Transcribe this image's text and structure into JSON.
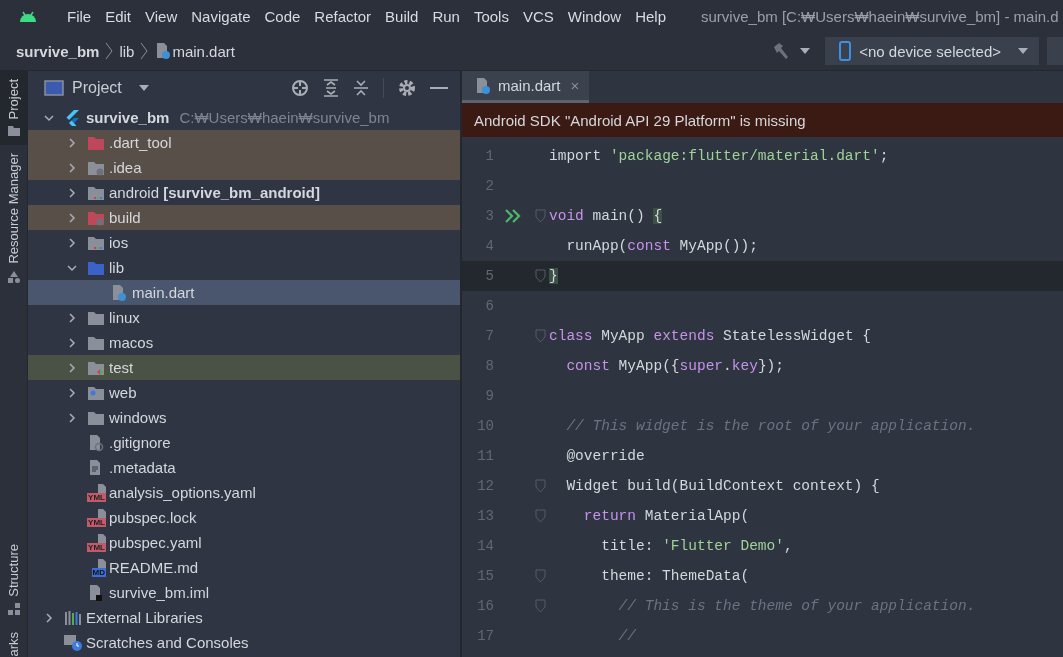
{
  "menu_bar": {
    "items": [
      "File",
      "Edit",
      "View",
      "Navigate",
      "Code",
      "Refactor",
      "Build",
      "Run",
      "Tools",
      "VCS",
      "Window",
      "Help"
    ],
    "window_title": "survive_bm [C:₩Users₩haein₩survive_bm] - main.d"
  },
  "breadcrumbs": [
    {
      "label": "survive_bm",
      "kind": "project"
    },
    {
      "label": "lib",
      "kind": "folder"
    },
    {
      "label": "main.dart",
      "kind": "file"
    }
  ],
  "device_selector": {
    "label": "<no device selected>"
  },
  "tool_strip": {
    "top": [
      {
        "label": "Project",
        "selected": true
      },
      {
        "label": "Resource Manager",
        "selected": false
      }
    ],
    "bottom": [
      {
        "label": "Structure",
        "selected": false
      },
      {
        "label": "arks",
        "selected": false
      }
    ]
  },
  "project_panel": {
    "title": "Project",
    "tree": [
      {
        "label": "survive_bm",
        "path": "C:₩Users₩haein₩survive_bm",
        "kind": "flutter",
        "expanded": true,
        "selected": false,
        "children": [
          {
            "label": ".dart_tool",
            "kind": "folder-excluded",
            "expanded": false,
            "selected": false,
            "color": "#584f48"
          },
          {
            "label": ".idea",
            "kind": "folder-config",
            "expanded": false,
            "selected": false,
            "color": "#584f48"
          },
          {
            "label": "android **[survive_bm_android]**",
            "kind": "folder-module",
            "expanded": false,
            "selected": false
          },
          {
            "label": "build",
            "kind": "folder-excluded-config",
            "expanded": false,
            "selected": false,
            "color": "#584f48"
          },
          {
            "label": "ios",
            "kind": "folder-module",
            "expanded": false,
            "selected": false
          },
          {
            "label": "lib",
            "kind": "folder-source",
            "expanded": true,
            "selected": false,
            "children": [
              {
                "label": "main.dart",
                "kind": "file-dart",
                "selected": true
              }
            ]
          },
          {
            "label": "linux",
            "kind": "folder",
            "expanded": false,
            "selected": false
          },
          {
            "label": "macos",
            "kind": "folder",
            "expanded": false,
            "selected": false
          },
          {
            "label": "test",
            "kind": "folder-test",
            "expanded": false,
            "selected": false,
            "color": "#495245"
          },
          {
            "label": "web",
            "kind": "folder-web",
            "expanded": false,
            "selected": false
          },
          {
            "label": "windows",
            "kind": "folder",
            "expanded": false,
            "selected": false
          },
          {
            "label": ".gitignore",
            "kind": "file-ignore",
            "selected": false
          },
          {
            "label": ".metadata",
            "kind": "file-text",
            "selected": false
          },
          {
            "label": "analysis_options.yaml",
            "kind": "file-badge",
            "badge": "YML",
            "selected": false
          },
          {
            "label": "pubspec.lock",
            "kind": "file-badge",
            "badge": "YML",
            "selected": false
          },
          {
            "label": "pubspec.yaml",
            "kind": "file-badge",
            "badge": "YML",
            "selected": false
          },
          {
            "label": "README.md",
            "kind": "file-badge",
            "badge": "MD",
            "selected": false
          },
          {
            "label": "survive_bm.iml",
            "kind": "file-iml",
            "selected": false
          }
        ]
      },
      {
        "label": "External Libraries",
        "kind": "libraries",
        "expanded": false,
        "selected": false
      },
      {
        "label": "Scratches and Consoles",
        "kind": "scratches",
        "selected": false
      }
    ]
  },
  "editor": {
    "tabs": [
      {
        "label": "main.dart",
        "selected": true,
        "close": "×"
      }
    ],
    "banner": "Android SDK \"Android API 29 Platform\" is missing",
    "lines": [
      {
        "number": "1",
        "tokens": [
          {
            "t": "import ",
            "kind": "plain"
          },
          {
            "t": "'package:flutter/material.dart'",
            "kind": "string"
          },
          {
            "t": ";",
            "kind": "plain"
          }
        ]
      },
      {
        "number": "2"
      },
      {
        "number": "3",
        "run": true,
        "fold": true,
        "tokens": [
          {
            "t": "void",
            "kind": "keyword"
          },
          {
            "t": " main() ",
            "kind": "plain"
          },
          {
            "t": "{",
            "kind": "brace-match"
          }
        ]
      },
      {
        "number": "4",
        "tokens": [
          {
            "t": "  runApp(",
            "kind": "plain"
          },
          {
            "t": "const",
            "kind": "keyword"
          },
          {
            "t": " MyApp());",
            "kind": "plain"
          }
        ]
      },
      {
        "number": "5",
        "current": true,
        "fold": true,
        "tokens": [
          {
            "t": "}",
            "kind": "brace-match"
          }
        ]
      },
      {
        "number": "6"
      },
      {
        "number": "7",
        "fold": true,
        "tokens": [
          {
            "t": "class",
            "kind": "keyword"
          },
          {
            "t": " MyApp ",
            "kind": "plain"
          },
          {
            "t": "extends",
            "kind": "keyword"
          },
          {
            "t": " StatelessWidget {",
            "kind": "plain"
          }
        ]
      },
      {
        "number": "8",
        "tokens": [
          {
            "t": "  const",
            "kind": "keyword"
          },
          {
            "t": " MyApp({",
            "kind": "plain"
          },
          {
            "t": "super",
            "kind": "keyword"
          },
          {
            "t": ".",
            "kind": "plain"
          },
          {
            "t": "key",
            "kind": "keyword"
          },
          {
            "t": "});",
            "kind": "plain"
          }
        ]
      },
      {
        "number": "9"
      },
      {
        "number": "10",
        "tokens": [
          {
            "t": "  // This widget is the root of your application.",
            "kind": "comment"
          }
        ]
      },
      {
        "number": "11",
        "tokens": [
          {
            "t": "  @override",
            "kind": "plain"
          }
        ]
      },
      {
        "number": "12",
        "fold": true,
        "tokens": [
          {
            "t": "  Widget build(BuildContext context) {",
            "kind": "plain"
          }
        ]
      },
      {
        "number": "13",
        "fold": true,
        "tokens": [
          {
            "t": "    return",
            "kind": "keyword"
          },
          {
            "t": " MaterialApp(",
            "kind": "plain"
          }
        ]
      },
      {
        "number": "14",
        "tokens": [
          {
            "t": "      title: ",
            "kind": "plain"
          },
          {
            "t": "'Flutter Demo'",
            "kind": "string"
          },
          {
            "t": ",",
            "kind": "plain"
          }
        ]
      },
      {
        "number": "15",
        "fold": true,
        "tokens": [
          {
            "t": "      theme: ThemeData(",
            "kind": "plain"
          }
        ]
      },
      {
        "number": "16",
        "fold": true,
        "tokens": [
          {
            "t": "        // This is the theme of your application.",
            "kind": "comment"
          }
        ]
      },
      {
        "number": "17",
        "tokens": [
          {
            "t": "        //",
            "kind": "comment"
          }
        ]
      }
    ]
  }
}
